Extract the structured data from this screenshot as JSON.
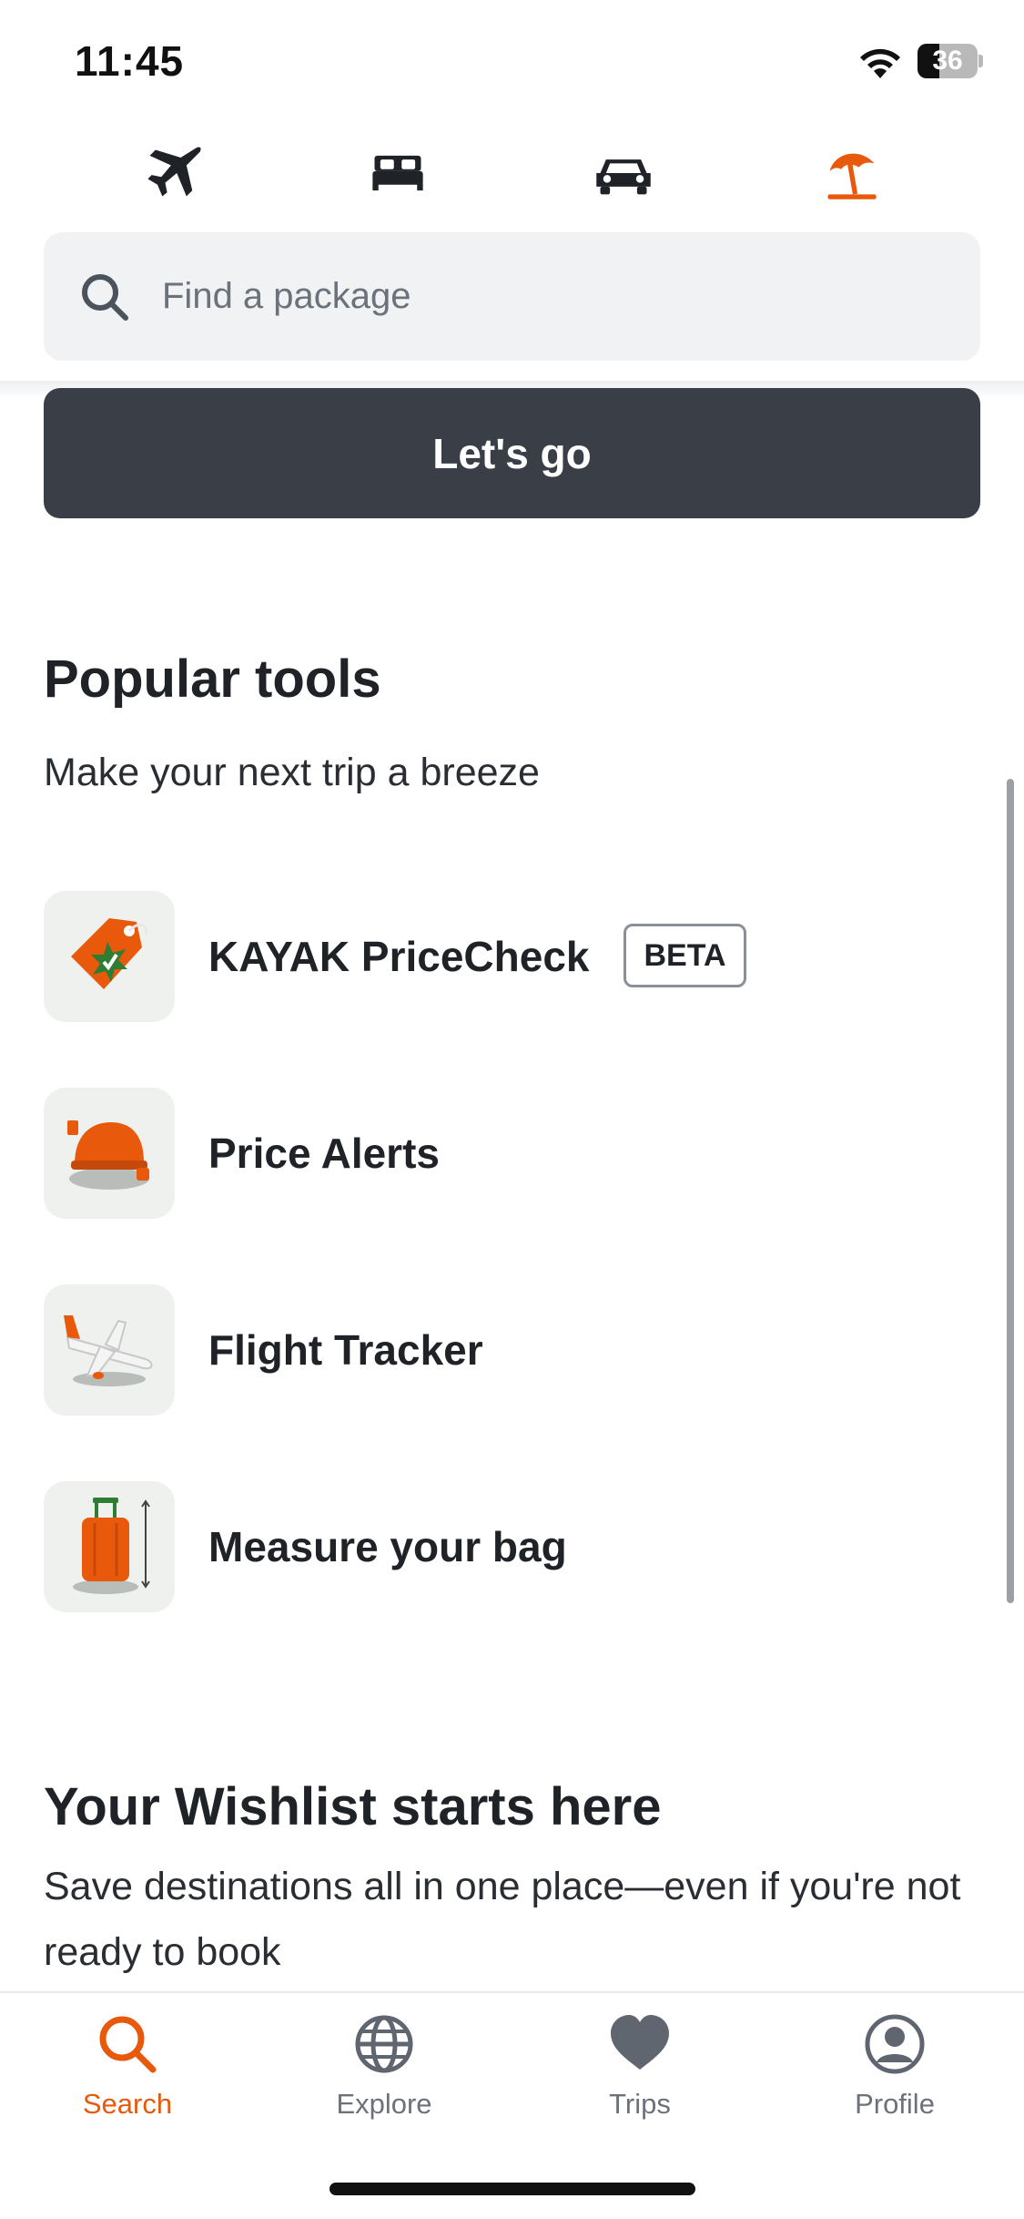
{
  "status_bar": {
    "time": "11:45",
    "battery": "36",
    "battery_level": 0.36
  },
  "vertical_tabs": [
    {
      "name": "flights",
      "icon": "airplane-icon",
      "active": false
    },
    {
      "name": "stays",
      "icon": "bed-icon",
      "active": false
    },
    {
      "name": "cars",
      "icon": "car-icon",
      "active": false
    },
    {
      "name": "packages",
      "icon": "beach-umbrella-icon",
      "active": true
    }
  ],
  "search": {
    "placeholder": "Find a package",
    "value": ""
  },
  "go_button": {
    "label": "Let's go"
  },
  "popular_tools": {
    "title": "Popular tools",
    "subtitle": "Make your next trip a breeze",
    "items": [
      {
        "label": "KAYAK PriceCheck",
        "badge": "BETA",
        "icon": "price-tag-icon"
      },
      {
        "label": "Price Alerts",
        "icon": "alert-bell-icon"
      },
      {
        "label": "Flight Tracker",
        "icon": "airplane-tracker-icon"
      },
      {
        "label": "Measure your bag",
        "icon": "suitcase-icon"
      }
    ]
  },
  "wishlist": {
    "title": "Your Wishlist starts here",
    "subtitle": "Save destinations all in one place—even if you're not ready to book"
  },
  "bottom_nav": [
    {
      "label": "Search",
      "icon": "search-icon",
      "active": true
    },
    {
      "label": "Explore",
      "icon": "globe-icon",
      "active": false
    },
    {
      "label": "Trips",
      "icon": "heart-icon",
      "active": false
    },
    {
      "label": "Profile",
      "icon": "profile-icon",
      "active": false
    }
  ],
  "colors": {
    "accent": "#e8590c",
    "button": "#3a3f47",
    "text": "#1f2328",
    "muted": "#6b727b"
  }
}
